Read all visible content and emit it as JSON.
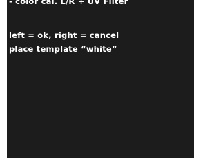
{
  "display": {
    "lines": [
      "- color cal. L/R + UV Filter",
      "left = ok, right = cancel",
      "place template “white”"
    ]
  }
}
